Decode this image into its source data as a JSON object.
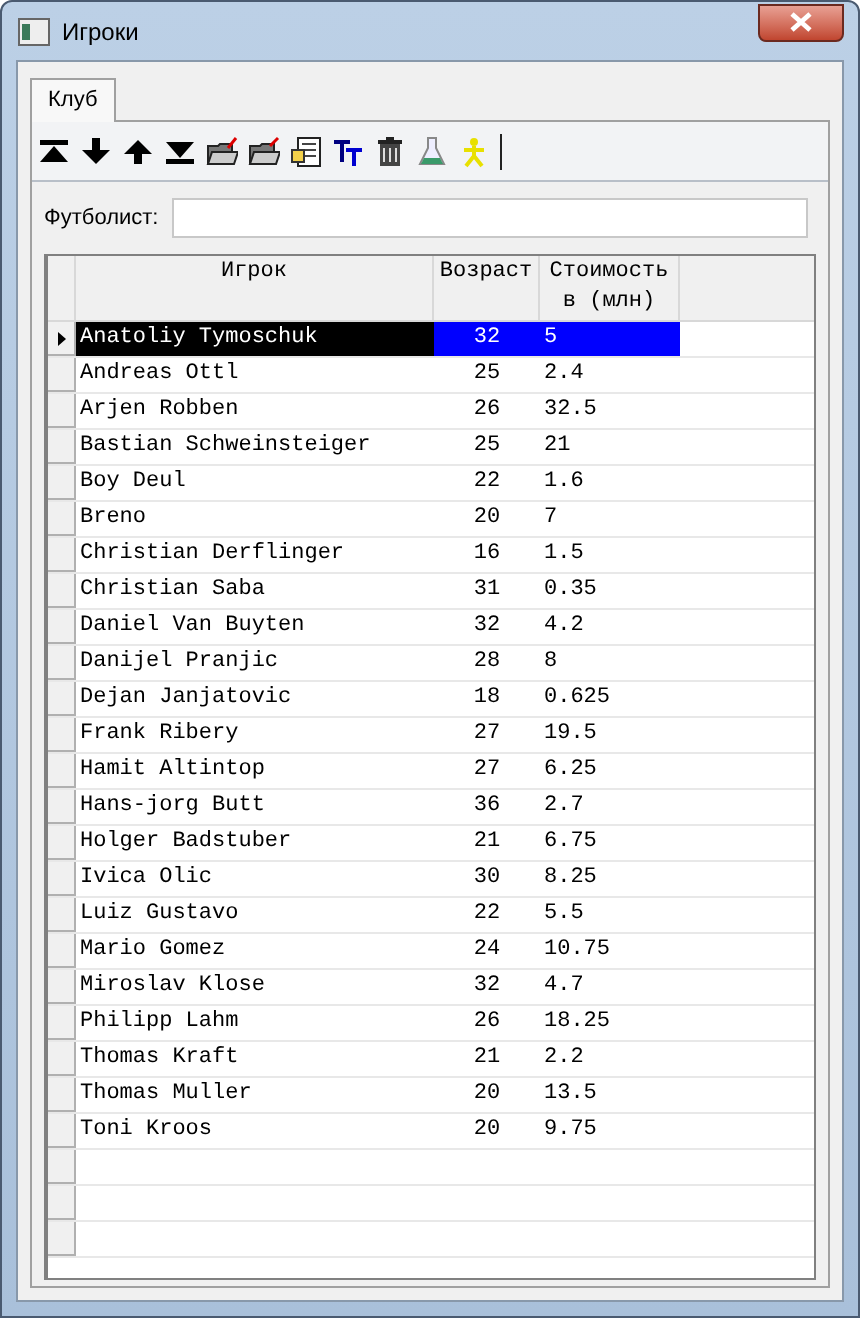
{
  "window": {
    "title": "Игроки"
  },
  "tabs": [
    {
      "label": "Клуб",
      "selected": true
    }
  ],
  "filter": {
    "label": "Футболист:"
  },
  "table": {
    "columns": [
      "Игрок",
      "Возраст",
      "Стоимость в (млн)"
    ],
    "rows": [
      {
        "cells": [
          "Anatoliy Tymoschuk",
          "32",
          "5"
        ],
        "selected": true
      },
      {
        "cells": [
          "Andreas Ottl",
          "25",
          "2.4"
        ],
        "selected": false
      },
      {
        "cells": [
          "Arjen Robben",
          "26",
          "32.5"
        ],
        "selected": false
      },
      {
        "cells": [
          "Bastian Schweinsteiger",
          "25",
          "21"
        ],
        "selected": false
      },
      {
        "cells": [
          "Boy Deul",
          "22",
          "1.6"
        ],
        "selected": false
      },
      {
        "cells": [
          "Breno",
          "20",
          "7"
        ],
        "selected": false
      },
      {
        "cells": [
          "Christian Derflinger",
          "16",
          "1.5"
        ],
        "selected": false
      },
      {
        "cells": [
          "Christian Saba",
          "31",
          "0.35"
        ],
        "selected": false
      },
      {
        "cells": [
          "Daniel Van Buyten",
          "32",
          "4.2"
        ],
        "selected": false
      },
      {
        "cells": [
          "Danijel Pranjic",
          "28",
          "8"
        ],
        "selected": false
      },
      {
        "cells": [
          "Dejan Janjatovic",
          "18",
          "0.625"
        ],
        "selected": false
      },
      {
        "cells": [
          "Frank Ribery",
          "27",
          "19.5"
        ],
        "selected": false
      },
      {
        "cells": [
          "Hamit Altintop",
          "27",
          "6.25"
        ],
        "selected": false
      },
      {
        "cells": [
          "Hans-jorg Butt",
          "36",
          "2.7"
        ],
        "selected": false
      },
      {
        "cells": [
          "Holger Badstuber",
          "21",
          "6.75"
        ],
        "selected": false
      },
      {
        "cells": [
          "Ivica Olic",
          "30",
          "8.25"
        ],
        "selected": false
      },
      {
        "cells": [
          "Luiz Gustavo",
          "22",
          "5.5"
        ],
        "selected": false
      },
      {
        "cells": [
          "Mario Gomez",
          "24",
          "10.75"
        ],
        "selected": false
      },
      {
        "cells": [
          "Miroslav Klose",
          "32",
          "4.7"
        ],
        "selected": false
      },
      {
        "cells": [
          "Philipp Lahm",
          "26",
          "18.25"
        ],
        "selected": false
      },
      {
        "cells": [
          "Thomas Kraft",
          "21",
          "2.2"
        ],
        "selected": false
      },
      {
        "cells": [
          "Thomas Muller",
          "20",
          "13.5"
        ],
        "selected": false
      },
      {
        "cells": [
          "Toni Kroos",
          "20",
          "9.75"
        ],
        "selected": false
      }
    ]
  }
}
